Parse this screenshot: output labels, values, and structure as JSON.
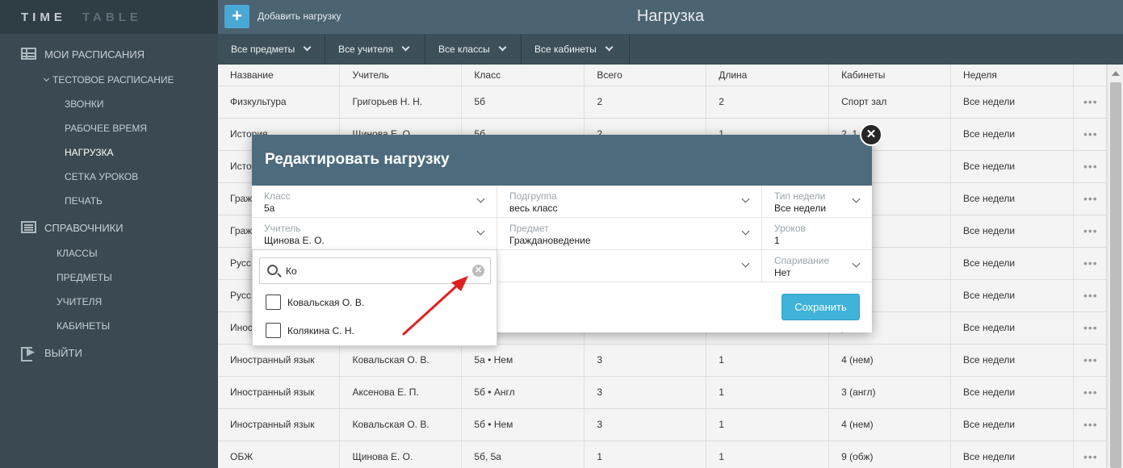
{
  "logo": {
    "part1": "TIME",
    "part2": "TABLE"
  },
  "sidebar": {
    "my_schedules": "МОИ РАСПИСАНИЯ",
    "test_schedule": "ТЕСТОВОЕ РАСПИСАНИЕ",
    "sub_items": [
      "ЗВОНКИ",
      "РАБОЧЕЕ ВРЕМЯ",
      "НАГРУЗКА",
      "СЕТКА УРОКОВ",
      "ПЕЧАТЬ"
    ],
    "active_item": "НАГРУЗКА",
    "references": "СПРАВОЧНИКИ",
    "ref_items": [
      "КЛАССЫ",
      "ПРЕДМЕТЫ",
      "УЧИТЕЛЯ",
      "КАБИНЕТЫ"
    ],
    "logout": "ВЫЙТИ"
  },
  "header": {
    "add_label": "Добавить нагрузку",
    "title": "Нагрузка",
    "add_icon": "+"
  },
  "filters": [
    "Все предметы",
    "Все учителя",
    "Все классы",
    "Все кабинеты"
  ],
  "table": {
    "columns": [
      "Название",
      "Учитель",
      "Класс",
      "Всего",
      "Длина",
      "Кабинеты",
      "Неделя"
    ],
    "rows": [
      [
        "Физкультура",
        "Григорьев Н. Н.",
        "5б",
        "2",
        "2",
        "Спорт зал",
        "Все недели"
      ],
      [
        "История",
        "Щинова Е. О.",
        "5б",
        "2",
        "1",
        "2, 1",
        "Все недели"
      ],
      [
        "История",
        "",
        "",
        "",
        "",
        "",
        "Все недели"
      ],
      [
        "Граж",
        "",
        "",
        "",
        "",
        "",
        "Все недели"
      ],
      [
        "Граж",
        "",
        "",
        "",
        "",
        "",
        "Все недели"
      ],
      [
        "Русс",
        "",
        "",
        "",
        "",
        "",
        "Все недели"
      ],
      [
        "Русс",
        "",
        "",
        "",
        "",
        "",
        "Все недели"
      ],
      [
        "Иност",
        "",
        "",
        "",
        "",
        ")",
        "Все недели"
      ],
      [
        "Иностранный язык",
        "Ковальская О. В.",
        "5а • Нем",
        "3",
        "1",
        "4 (нем)",
        "Все недели"
      ],
      [
        "Иностранный язык",
        "Аксенова Е. П.",
        "5б • Англ",
        "3",
        "1",
        "3 (англ)",
        "Все недели"
      ],
      [
        "Иностранный язык",
        "Ковальская О. В.",
        "5б • Нем",
        "3",
        "1",
        "4 (нем)",
        "Все недели"
      ],
      [
        "ОБЖ",
        "Щинова Е. О.",
        "5б, 5а",
        "1",
        "1",
        "9 (обж)",
        "Все недели"
      ]
    ],
    "row_menu": "•••"
  },
  "modal": {
    "title": "Редактировать нагрузку",
    "close": "✕",
    "fields": {
      "class_label": "Класс",
      "class_value": "5а",
      "subgroup_label": "Подгруппа",
      "subgroup_value": "весь класс",
      "week_type_label": "Тип недели",
      "week_type_value": "Все недели",
      "teacher_label": "Учитель",
      "teacher_value": "Щинова Е. О.",
      "subject_label": "Предмет",
      "subject_value": "Граждановедение",
      "lessons_label": "Уроков",
      "lessons_value": "1",
      "pairing_label": "Спаривание",
      "pairing_value": "Нет"
    },
    "save": "Сохранить"
  },
  "dropdown": {
    "search_value": "Ко",
    "clear": "✕",
    "options": [
      "Ковальская О. В.",
      "Колякина С. Н."
    ]
  },
  "colors": {
    "sidebar": "#3a4952",
    "topbar": "#4c6371",
    "modal_header": "#4d6b7d",
    "save": "#3fb3d9",
    "arrow": "#e02020"
  }
}
